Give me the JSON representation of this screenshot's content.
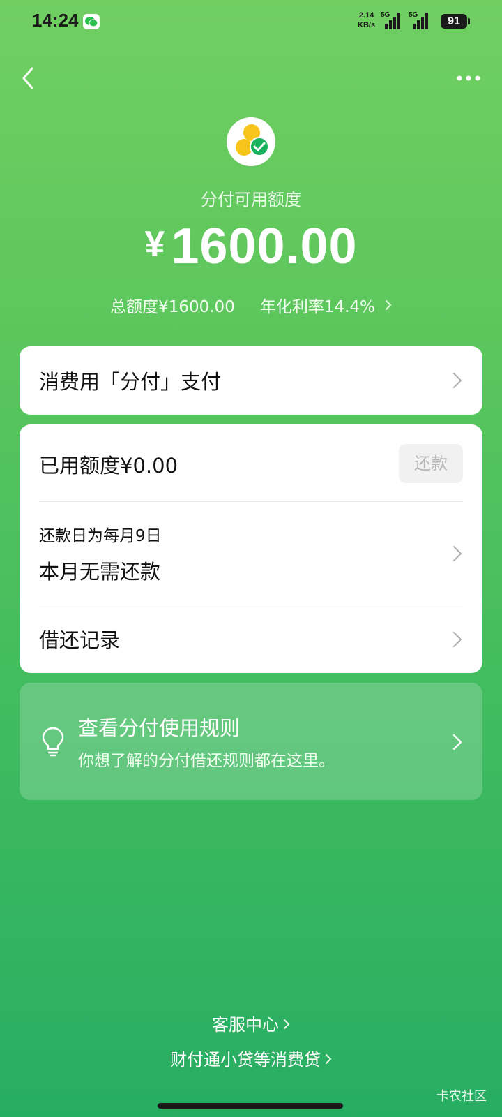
{
  "status_bar": {
    "time": "14:24",
    "net_speed_value": "2.14",
    "net_speed_unit": "KB/s",
    "signal1_label": "5G",
    "signal2_label": "5G",
    "battery": "91"
  },
  "header": {
    "back_icon": "chevron-left-icon",
    "more_icon": "more-horizontal-icon"
  },
  "summary": {
    "available_label": "分付可用额度",
    "currency": "¥",
    "available_amount": "1600.00",
    "total_limit": "总额度¥1600.00",
    "annual_rate": "年化利率14.4%"
  },
  "pay_card": {
    "label": "消费用「分付」支付"
  },
  "main_card": {
    "used_limit": "已用额度¥0.00",
    "repay_button": "还款",
    "repay_day": "还款日为每月9日",
    "repay_status": "本月无需还款",
    "records": "借还记录"
  },
  "rules_card": {
    "title": "查看分付使用规则",
    "subtitle": "你想了解的分付借还规则都在这里。",
    "icon": "lightbulb-icon"
  },
  "footer": {
    "service_center": "客服中心",
    "loan_info": "财付通小贷等消费贷"
  },
  "watermark": "卡农社区",
  "colors": {
    "gradient_top": "#71cf62",
    "gradient_bottom": "#27ad62",
    "card_bg": "#ffffff",
    "chevron": "#b0b0b0"
  }
}
